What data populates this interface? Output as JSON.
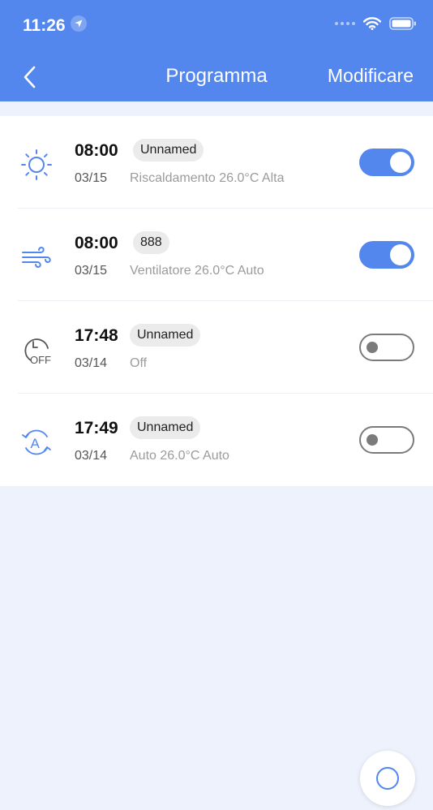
{
  "status_bar": {
    "time": "11:26"
  },
  "nav": {
    "title": "Programma",
    "edit_label": "Modificare"
  },
  "colors": {
    "accent": "#5387ee",
    "background": "#edf2fc",
    "toggle_off": "#7b7b7b"
  },
  "schedules": [
    {
      "icon": "sun-icon",
      "time": "08:00",
      "name": "Unnamed",
      "date": "03/15",
      "description": "Riscaldamento 26.0°C Alta",
      "enabled": true
    },
    {
      "icon": "wind-icon",
      "time": "08:00",
      "name": "888",
      "date": "03/15",
      "description": "Ventilatore 26.0°C Auto",
      "enabled": true
    },
    {
      "icon": "clock-off-icon",
      "time": "17:48",
      "name": "Unnamed",
      "date": "03/14",
      "description": "Off",
      "enabled": false
    },
    {
      "icon": "auto-mode-icon",
      "time": "17:49",
      "name": "Unnamed",
      "date": "03/14",
      "description": "Auto 26.0°C Auto",
      "enabled": false
    }
  ]
}
